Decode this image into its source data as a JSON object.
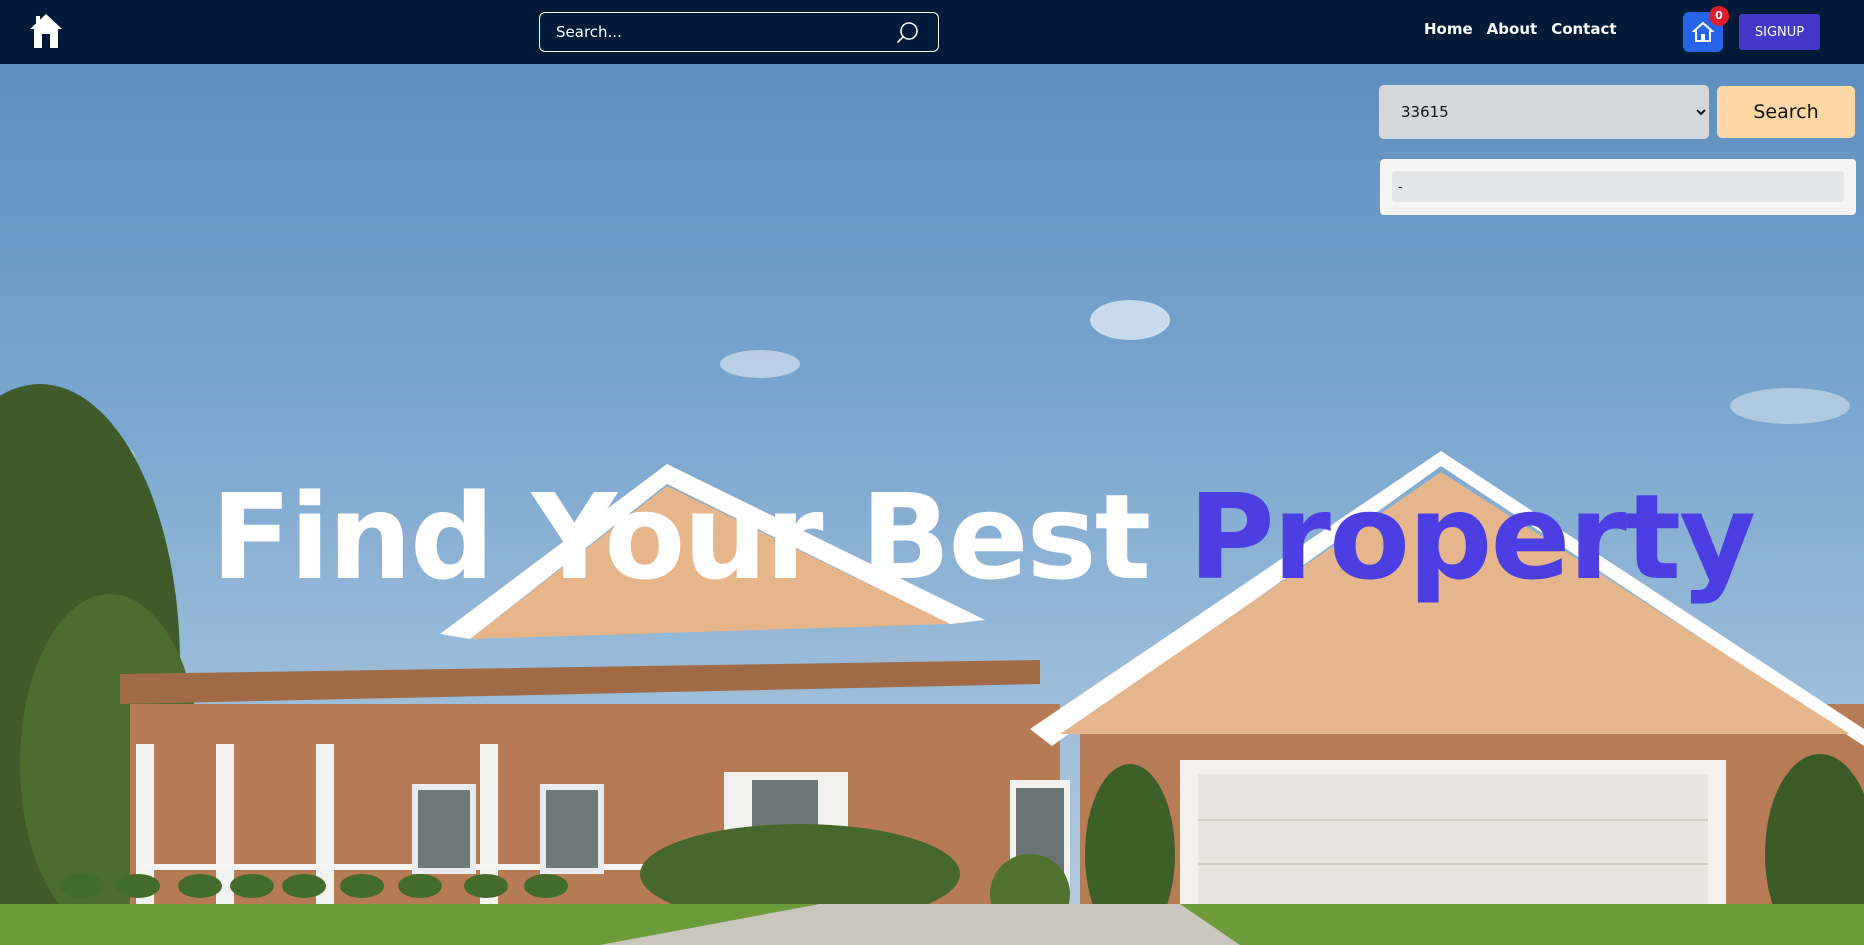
{
  "navbar": {
    "logo_icon": "home-icon",
    "search_placeholder": "Search...",
    "search_icon": "magnifier-icon",
    "links": [
      "Home",
      "About",
      "Contact"
    ],
    "cart_count": "0",
    "cart_icon": "house-outline-icon",
    "signup_label": "SIGNUP"
  },
  "zip_search": {
    "selected_zip": "33615",
    "button_label": "Search",
    "result_value": "-"
  },
  "hero": {
    "headline_main": "Find Your Best",
    "headline_accent": "Property"
  },
  "colors": {
    "navbar_bg": "#001a3a",
    "accent": "#4b3fe4",
    "signup_bg": "#4338ca",
    "cart_bg": "#2563eb",
    "badge_bg": "#e11d2c",
    "search_button_bg": "#fdd7a4"
  }
}
